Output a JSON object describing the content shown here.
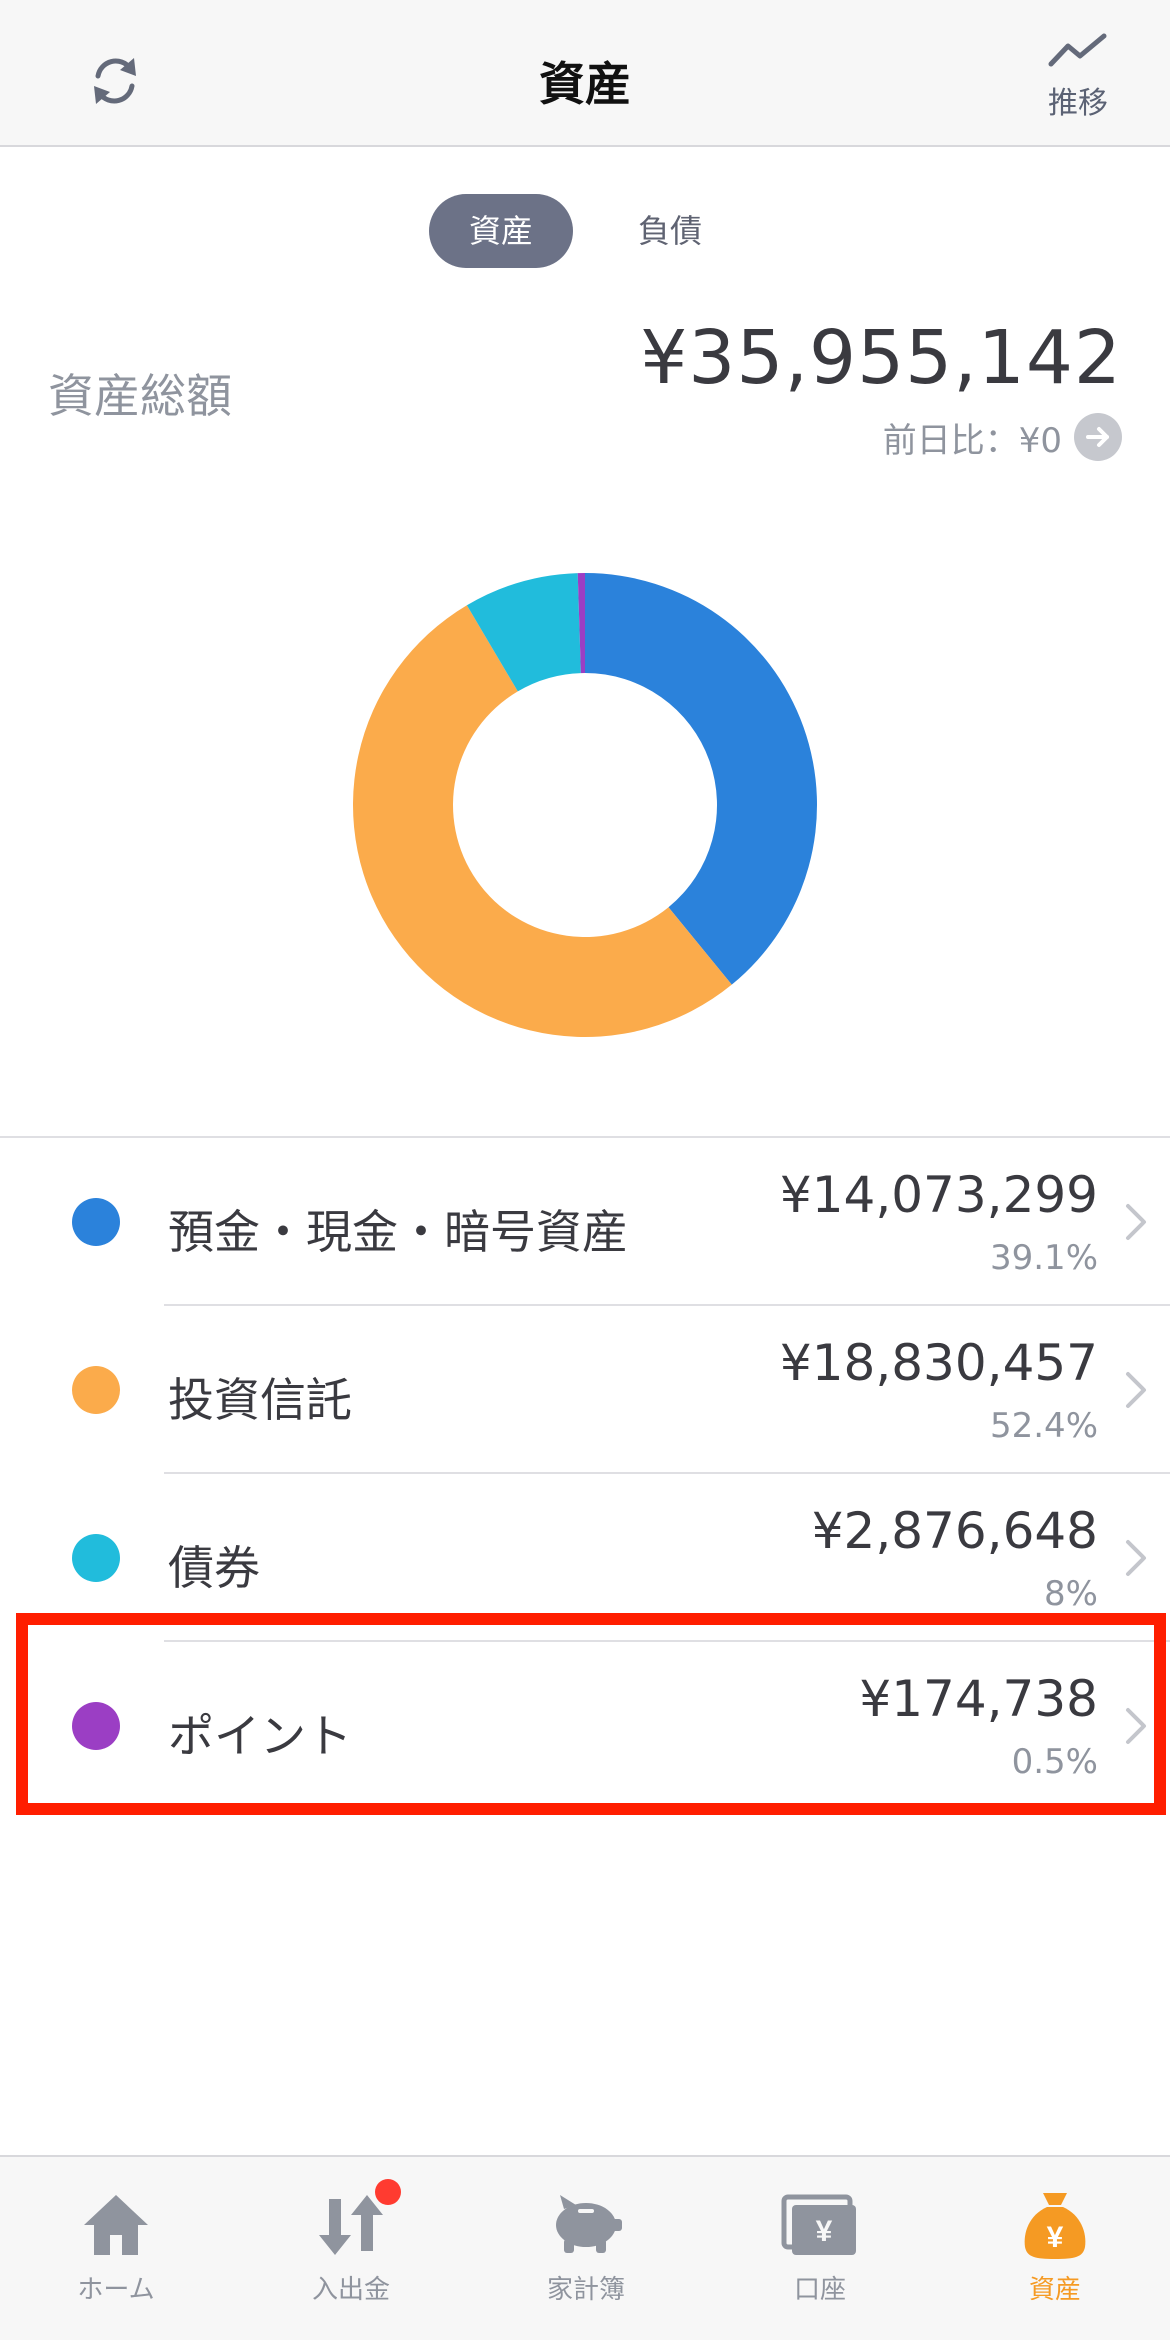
{
  "header": {
    "title": "資産",
    "trend_label": "推移"
  },
  "segment": {
    "assets_label": "資産",
    "liabilities_label": "負債"
  },
  "summary": {
    "total_label": "資産総額",
    "total_value": "¥35,955,142",
    "day_change": "前日比：¥0"
  },
  "chart_data": {
    "type": "pie",
    "categories": [
      "預金・現金・暗号資産",
      "投資信託",
      "債券",
      "ポイント"
    ],
    "values": [
      39.1,
      52.4,
      8.0,
      0.5
    ],
    "colors": [
      "#2b82db",
      "#fbab4b",
      "#21bcdc",
      "#9b3ec4"
    ],
    "donut": true
  },
  "assets": [
    {
      "name": "預金・現金・暗号資産",
      "amount": "¥14,073,299",
      "percent": "39.1%",
      "color": "#2b82db"
    },
    {
      "name": "投資信託",
      "amount": "¥18,830,457",
      "percent": "52.4%",
      "color": "#fbab4b"
    },
    {
      "name": "債券",
      "amount": "¥2,876,648",
      "percent": "8%",
      "color": "#21bcdc"
    },
    {
      "name": "ポイント",
      "amount": "¥174,738",
      "percent": "0.5%",
      "color": "#9b3ec4"
    }
  ],
  "highlight_color": "#ff1e00",
  "tabs": [
    {
      "label": "ホーム",
      "icon": "home-icon"
    },
    {
      "label": "入出金",
      "icon": "transfer-arrows-icon",
      "badge": true
    },
    {
      "label": "家計簿",
      "icon": "piggy-bank-icon"
    },
    {
      "label": "口座",
      "icon": "wallet-yen-icon"
    },
    {
      "label": "資産",
      "icon": "money-bag-yen-icon",
      "active": true
    }
  ]
}
